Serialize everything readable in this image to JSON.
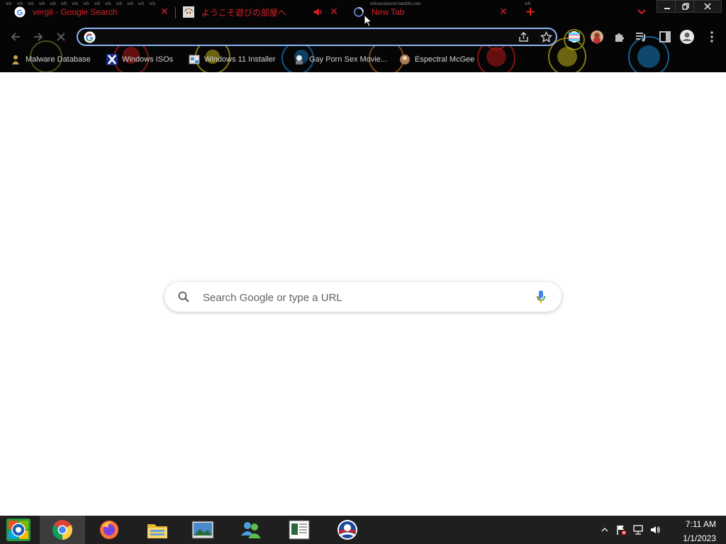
{
  "tabs": [
    {
      "title": "vergil - Google Search",
      "favicon": "google-g-icon"
    },
    {
      "title": "ようこそ遊びの部屋へ",
      "favicon": "anime-avatar-icon",
      "muted_audio_icon": "speaker-icon"
    },
    {
      "title": "New Tab",
      "favicon": "loading-icon",
      "active": true
    }
  ],
  "tiny_text": {
    "left": "wh",
    "right": "whosoanswer.tumblr.com",
    "far_right": "wh"
  },
  "omnibox": {
    "value": "",
    "placeholder": ""
  },
  "bookmarks": [
    {
      "label": "Malware Database",
      "icon": "malware-icon"
    },
    {
      "label": "Windows ISOs",
      "icon": "x-logo-icon"
    },
    {
      "label": "Windows 11 Installer",
      "icon": "installer-icon"
    },
    {
      "label": "Gay Porn Sex Movie...",
      "icon": "bookmark-icon"
    },
    {
      "label": "Espectral McGee",
      "icon": "avatar-icon"
    }
  ],
  "ntp": {
    "search_placeholder": "Search Google or type a URL"
  },
  "taskbar": {
    "apps": [
      "start-orb",
      "chrome",
      "firefox",
      "file-explorer",
      "photos",
      "network-app",
      "notepad-app",
      "obama-logo-app"
    ],
    "clock": {
      "time": "7:11 AM",
      "date": "1/1/2023"
    }
  },
  "colors": {
    "accent": "#8ab4f8",
    "tab_text": "#d8202a",
    "taskbar": "#1f1f1f"
  }
}
